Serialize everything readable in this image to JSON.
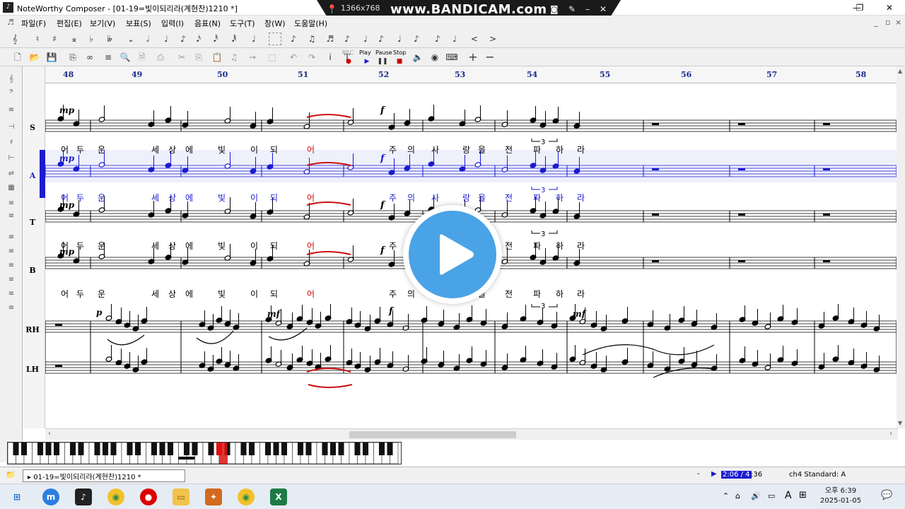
{
  "window": {
    "title": "NoteWorthy Composer - [01-19=빛이되리라(계현찬)1210 *]",
    "app_icon": "noteworthy-logo-icon"
  },
  "recorder": {
    "resolution": "1366x768",
    "brand": "www.BANDICAM.com"
  },
  "menu": [
    "파일(F)",
    "편집(E)",
    "보기(V)",
    "보표(S)",
    "입력(I)",
    "음표(N)",
    "도구(T)",
    "창(W)",
    "도움말(H)"
  ],
  "toolbar2": {
    "play": "Play",
    "pause": "Pause",
    "stop": "Stop",
    "rec": "REC"
  },
  "staffs": [
    "S",
    "A",
    "T",
    "B",
    "RH",
    "LH"
  ],
  "measures": [
    "48",
    "49",
    "50",
    "51",
    "52",
    "53",
    "54",
    "55",
    "56",
    "57",
    "58"
  ],
  "dynamics": {
    "mp": "mp",
    "f": "f",
    "p": "p",
    "mf": "mf"
  },
  "triplet": "3",
  "lyrics": {
    "s": [
      "어",
      "두",
      "운",
      "세",
      "상",
      "에",
      "빛",
      "이",
      "되",
      "어",
      "주",
      "의",
      "사",
      "랑",
      "을",
      "전",
      "파",
      "하",
      "라"
    ],
    "a": [
      "어",
      "두",
      "운",
      "세",
      "상",
      "에",
      "빛",
      "이",
      "되",
      "어",
      "주",
      "의",
      "사",
      "랑",
      "을",
      "전",
      "파",
      "하",
      "라"
    ],
    "t": [
      "어",
      "두",
      "운",
      "세",
      "상",
      "에",
      "빛",
      "이",
      "되",
      "어",
      "주",
      "의",
      "사",
      "랑",
      "을",
      "전",
      "파",
      "하",
      "라"
    ],
    "b": [
      "어",
      "두",
      "운",
      "세",
      "상",
      "에",
      "빛",
      "이",
      "되",
      "어",
      "주",
      "의",
      "사",
      "랑",
      "을",
      "전",
      "파",
      "하",
      "라"
    ]
  },
  "status": {
    "file": "01-19=빛이되리라(계현찬)1210 *",
    "position": "2:06 / 4",
    "position2": ":36",
    "channel": "ch4 Standard: A"
  },
  "taskbar": {
    "time": "오후 6:39",
    "date": "2025-01-05",
    "lang": "A"
  },
  "colors": {
    "selection": "#1b1bd0",
    "tie_red": "#cc1111",
    "playhead": "#e01010",
    "play_button": "#4aa3e6"
  }
}
